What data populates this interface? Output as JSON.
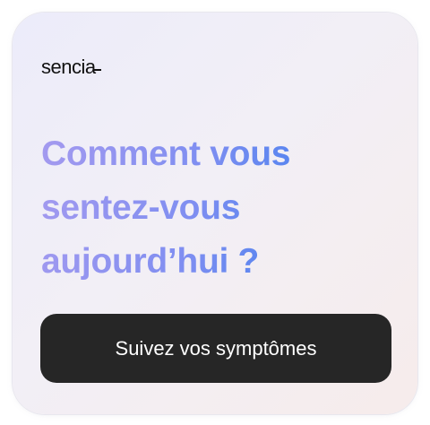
{
  "brand": {
    "name": "sencia"
  },
  "headline": {
    "text": "Comment vous\nsentez-vous\naujourd’hui ?"
  },
  "cta": {
    "label": "Suivez vos symptômes"
  },
  "colors": {
    "button_bg": "#262626",
    "button_text": "#FFFFFF",
    "headline_gradient_start": "#A49AEF",
    "headline_gradient_end": "#3E7FEE"
  }
}
